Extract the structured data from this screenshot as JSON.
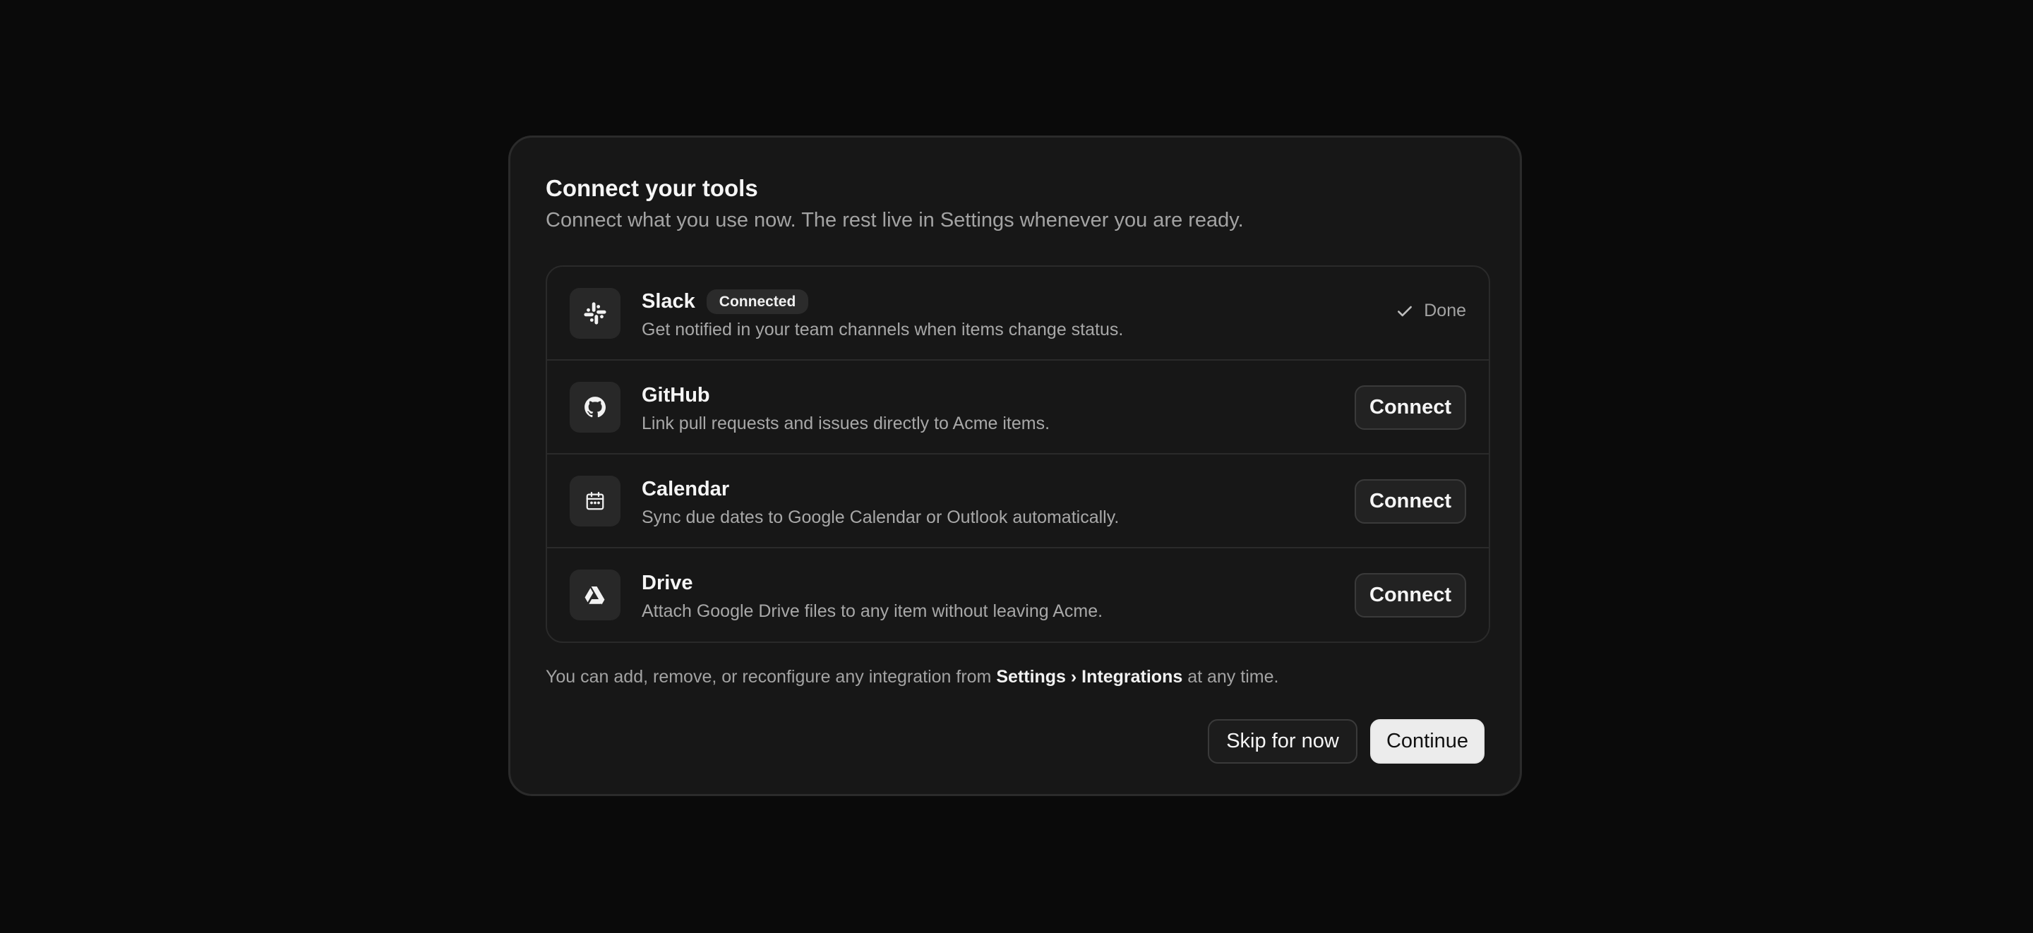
{
  "dialog": {
    "title": "Connect your tools",
    "subtitle": "Connect what you use now. The rest live in Settings whenever you are ready."
  },
  "integrations": [
    {
      "name": "Slack",
      "badge": "Connected",
      "description": "Get notified in your team channels when items change status.",
      "status": "Done",
      "icon": "slack-icon"
    },
    {
      "name": "GitHub",
      "description": "Link pull requests and issues directly to Acme items.",
      "action": "Connect",
      "icon": "github-icon"
    },
    {
      "name": "Calendar",
      "description": "Sync due dates to Google Calendar or Outlook automatically.",
      "action": "Connect",
      "icon": "calendar-icon"
    },
    {
      "name": "Drive",
      "description": "Attach Google Drive files to any item without leaving Acme.",
      "action": "Connect",
      "icon": "drive-icon"
    }
  ],
  "footnote": {
    "prefix": "You can add, remove, or reconfigure any integration from ",
    "path": "Settings › Integrations",
    "suffix": " at any time."
  },
  "actions": {
    "skip_label": "Skip for now",
    "continue_label": "Continue"
  },
  "colors": {
    "background": "#0a0a0a",
    "dialog": "#171717",
    "primary_button": "#ececec"
  }
}
